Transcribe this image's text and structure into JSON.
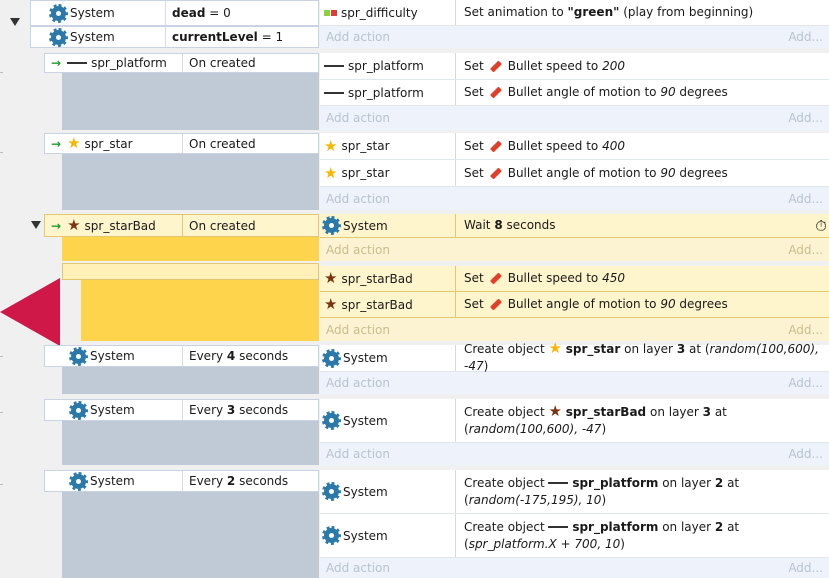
{
  "top": {
    "conditions": [
      {
        "object": "System",
        "var": "dead",
        "op": "= 0"
      },
      {
        "object": "System",
        "var": "currentLevel",
        "op": "= 1"
      }
    ],
    "action": {
      "object": "spr_difficulty",
      "pre": "Set animation to ",
      "bold": "\"green\"",
      "post": " (play from beginning)"
    }
  },
  "labels": {
    "add_action": "Add action",
    "add_dots": "Add..."
  },
  "blocks": [
    {
      "object": "spr_platform",
      "trigger": "On created",
      "actions": [
        {
          "object": "spr_platform",
          "set": "Set",
          "prop": "Bullet speed to ",
          "val": "200",
          "tail": ""
        },
        {
          "object": "spr_platform",
          "set": "Set",
          "prop": "Bullet angle of motion to ",
          "val": "90",
          "tail": " degrees"
        }
      ]
    },
    {
      "object": "spr_star",
      "trigger": "On created",
      "actions": [
        {
          "object": "spr_star",
          "set": "Set",
          "prop": "Bullet speed to ",
          "val": "400",
          "tail": ""
        },
        {
          "object": "spr_star",
          "set": "Set",
          "prop": "Bullet angle of motion to ",
          "val": "90",
          "tail": " degrees"
        }
      ]
    },
    {
      "object": "spr_starBad",
      "trigger": "On created",
      "actions": [
        {
          "object": "System",
          "pre": "Wait ",
          "bold": "8",
          "post": " seconds"
        }
      ],
      "sub": [
        {
          "object": "spr_starBad",
          "set": "Set",
          "prop": "Bullet speed to ",
          "val": "450",
          "tail": ""
        },
        {
          "object": "spr_starBad",
          "set": "Set",
          "prop": "Bullet angle of motion to ",
          "val": "90",
          "tail": " degrees"
        }
      ]
    },
    {
      "object": "System",
      "trigger_pre": "Every ",
      "trigger_bold": "4",
      "trigger_post": " seconds",
      "action": {
        "object": "System",
        "pre": "Create object ",
        "name": "spr_star",
        "mid": " on layer ",
        "layer": "3",
        "at": " at (",
        "expr": "random(100,600), -47",
        "close": ")"
      }
    },
    {
      "object": "System",
      "trigger_pre": "Every ",
      "trigger_bold": "3",
      "trigger_post": " seconds",
      "action": {
        "object": "System",
        "pre": "Create object ",
        "name": "spr_starBad",
        "mid": " on layer ",
        "layer": "3",
        "at": " at (",
        "expr": "random(100,600), -47",
        "close": ")"
      }
    },
    {
      "object": "System",
      "trigger_pre": "Every ",
      "trigger_bold": "2",
      "trigger_post": " seconds",
      "actions": [
        {
          "object": "System",
          "pre": "Create object ",
          "name": "spr_platform",
          "mid": " on layer ",
          "layer": "2",
          "at": " at (",
          "expr": "random(-175,195), 10",
          "close": ")"
        },
        {
          "object": "System",
          "pre": "Create object ",
          "name": "spr_platform",
          "mid": " on layer ",
          "layer": "2",
          "at": " at (",
          "expr": "spr_platform.X + 700, 10",
          "close": ")"
        }
      ]
    }
  ],
  "colors": {
    "accent": "#cf1748",
    "highlight": "#ffd44d",
    "highlight_light": "#fff5cc"
  }
}
